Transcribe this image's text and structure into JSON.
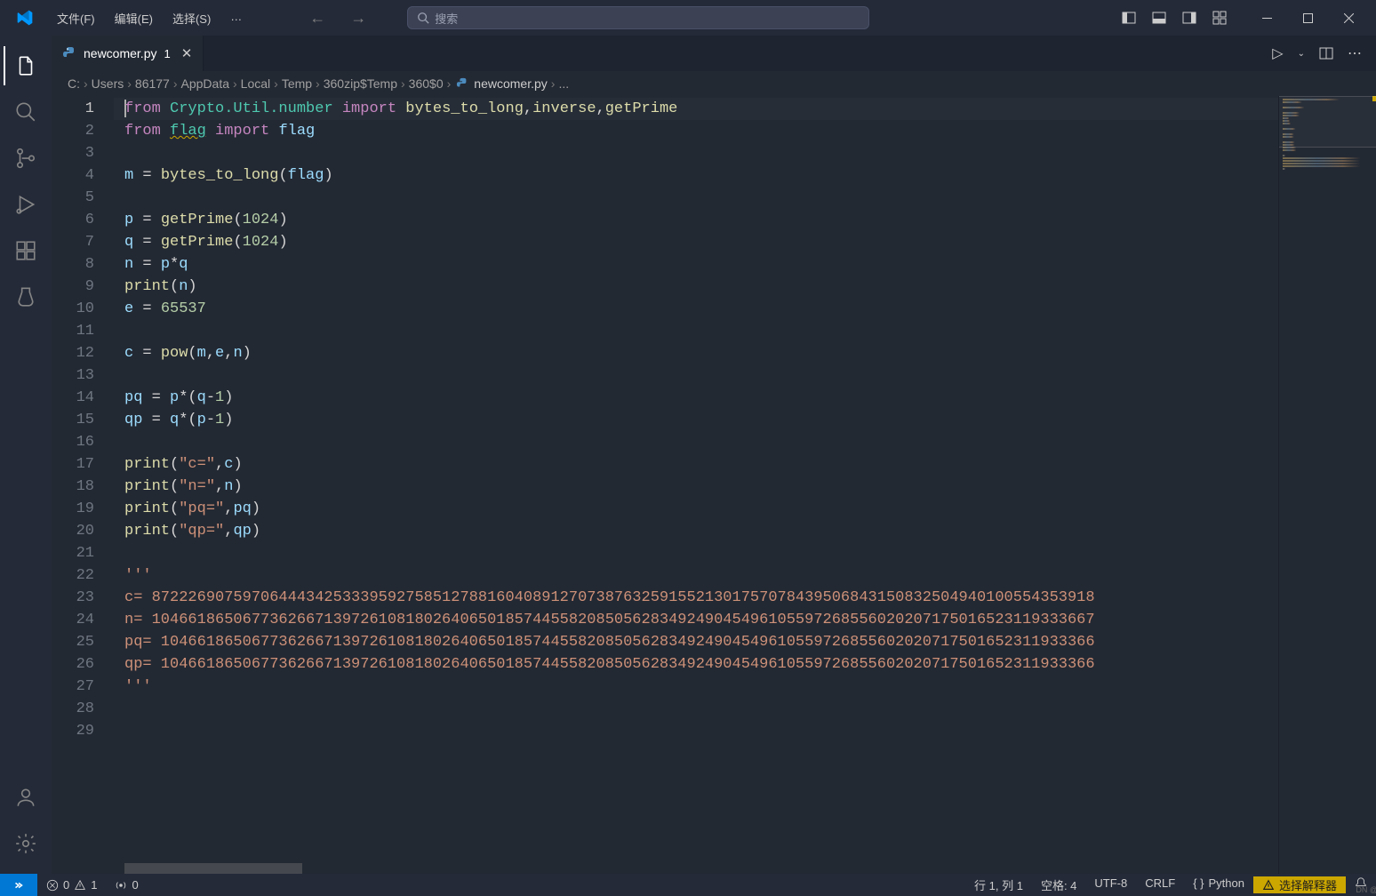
{
  "titlebar": {
    "menu": [
      "文件(F)",
      "编辑(E)",
      "选择(S)",
      "…"
    ],
    "searchPlaceholder": "搜索"
  },
  "tab": {
    "filename": "newcomer.py",
    "modified_indicator": "1"
  },
  "breadcrumb": [
    "C:",
    "Users",
    "86177",
    "AppData",
    "Local",
    "Temp",
    "360zip$Temp",
    "360$0",
    "newcomer.py",
    "..."
  ],
  "code": {
    "lines": [
      {
        "n": 1,
        "tokens": [
          {
            "t": "k",
            "v": "from"
          },
          {
            "t": "p",
            "v": " "
          },
          {
            "t": "t",
            "v": "Crypto.Util.number"
          },
          {
            "t": "p",
            "v": " "
          },
          {
            "t": "k",
            "v": "import"
          },
          {
            "t": "p",
            "v": " "
          },
          {
            "t": "f",
            "v": "bytes_to_long"
          },
          {
            "t": "p",
            "v": ","
          },
          {
            "t": "f",
            "v": "inverse"
          },
          {
            "t": "p",
            "v": ","
          },
          {
            "t": "f",
            "v": "getPrime"
          }
        ],
        "current": true,
        "cursor": true
      },
      {
        "n": 2,
        "tokens": [
          {
            "t": "k",
            "v": "from"
          },
          {
            "t": "p",
            "v": " "
          },
          {
            "t": "t underline",
            "v": "flag"
          },
          {
            "t": "p",
            "v": " "
          },
          {
            "t": "k",
            "v": "import"
          },
          {
            "t": "p",
            "v": " "
          },
          {
            "t": "v",
            "v": "flag"
          }
        ]
      },
      {
        "n": 3,
        "tokens": []
      },
      {
        "n": 4,
        "tokens": [
          {
            "t": "v",
            "v": "m"
          },
          {
            "t": "p",
            "v": " = "
          },
          {
            "t": "f",
            "v": "bytes_to_long"
          },
          {
            "t": "p",
            "v": "("
          },
          {
            "t": "v",
            "v": "flag"
          },
          {
            "t": "p",
            "v": ")"
          }
        ]
      },
      {
        "n": 5,
        "tokens": []
      },
      {
        "n": 6,
        "tokens": [
          {
            "t": "v",
            "v": "p"
          },
          {
            "t": "p",
            "v": " = "
          },
          {
            "t": "f",
            "v": "getPrime"
          },
          {
            "t": "p",
            "v": "("
          },
          {
            "t": "n",
            "v": "1024"
          },
          {
            "t": "p",
            "v": ")"
          }
        ]
      },
      {
        "n": 7,
        "tokens": [
          {
            "t": "v",
            "v": "q"
          },
          {
            "t": "p",
            "v": " = "
          },
          {
            "t": "f",
            "v": "getPrime"
          },
          {
            "t": "p",
            "v": "("
          },
          {
            "t": "n",
            "v": "1024"
          },
          {
            "t": "p",
            "v": ")"
          }
        ]
      },
      {
        "n": 8,
        "tokens": [
          {
            "t": "v",
            "v": "n"
          },
          {
            "t": "p",
            "v": " = "
          },
          {
            "t": "v",
            "v": "p"
          },
          {
            "t": "p",
            "v": "*"
          },
          {
            "t": "v",
            "v": "q"
          }
        ]
      },
      {
        "n": 9,
        "tokens": [
          {
            "t": "f",
            "v": "print"
          },
          {
            "t": "p",
            "v": "("
          },
          {
            "t": "v",
            "v": "n"
          },
          {
            "t": "p",
            "v": ")"
          }
        ]
      },
      {
        "n": 10,
        "tokens": [
          {
            "t": "v",
            "v": "e"
          },
          {
            "t": "p",
            "v": " = "
          },
          {
            "t": "n",
            "v": "65537"
          }
        ]
      },
      {
        "n": 11,
        "tokens": []
      },
      {
        "n": 12,
        "tokens": [
          {
            "t": "v",
            "v": "c"
          },
          {
            "t": "p",
            "v": " = "
          },
          {
            "t": "f",
            "v": "pow"
          },
          {
            "t": "p",
            "v": "("
          },
          {
            "t": "v",
            "v": "m"
          },
          {
            "t": "p",
            "v": ","
          },
          {
            "t": "v",
            "v": "e"
          },
          {
            "t": "p",
            "v": ","
          },
          {
            "t": "v",
            "v": "n"
          },
          {
            "t": "p",
            "v": ")"
          }
        ]
      },
      {
        "n": 13,
        "tokens": []
      },
      {
        "n": 14,
        "tokens": [
          {
            "t": "v",
            "v": "pq"
          },
          {
            "t": "p",
            "v": " = "
          },
          {
            "t": "v",
            "v": "p"
          },
          {
            "t": "p",
            "v": "*("
          },
          {
            "t": "v",
            "v": "q"
          },
          {
            "t": "p",
            "v": "-"
          },
          {
            "t": "n",
            "v": "1"
          },
          {
            "t": "p",
            "v": ")"
          }
        ]
      },
      {
        "n": 15,
        "tokens": [
          {
            "t": "v",
            "v": "qp"
          },
          {
            "t": "p",
            "v": " = "
          },
          {
            "t": "v",
            "v": "q"
          },
          {
            "t": "p",
            "v": "*("
          },
          {
            "t": "v",
            "v": "p"
          },
          {
            "t": "p",
            "v": "-"
          },
          {
            "t": "n",
            "v": "1"
          },
          {
            "t": "p",
            "v": ")"
          }
        ]
      },
      {
        "n": 16,
        "tokens": []
      },
      {
        "n": 17,
        "tokens": [
          {
            "t": "f",
            "v": "print"
          },
          {
            "t": "p",
            "v": "("
          },
          {
            "t": "s",
            "v": "\"c=\""
          },
          {
            "t": "p",
            "v": ","
          },
          {
            "t": "v",
            "v": "c"
          },
          {
            "t": "p",
            "v": ")"
          }
        ]
      },
      {
        "n": 18,
        "tokens": [
          {
            "t": "f",
            "v": "print"
          },
          {
            "t": "p",
            "v": "("
          },
          {
            "t": "s",
            "v": "\"n=\""
          },
          {
            "t": "p",
            "v": ","
          },
          {
            "t": "v",
            "v": "n"
          },
          {
            "t": "p",
            "v": ")"
          }
        ]
      },
      {
        "n": 19,
        "tokens": [
          {
            "t": "f",
            "v": "print"
          },
          {
            "t": "p",
            "v": "("
          },
          {
            "t": "s",
            "v": "\"pq=\""
          },
          {
            "t": "p",
            "v": ","
          },
          {
            "t": "v",
            "v": "pq"
          },
          {
            "t": "p",
            "v": ")"
          }
        ]
      },
      {
        "n": 20,
        "tokens": [
          {
            "t": "f",
            "v": "print"
          },
          {
            "t": "p",
            "v": "("
          },
          {
            "t": "s",
            "v": "\"qp=\""
          },
          {
            "t": "p",
            "v": ","
          },
          {
            "t": "v",
            "v": "qp"
          },
          {
            "t": "p",
            "v": ")"
          }
        ]
      },
      {
        "n": 21,
        "tokens": []
      },
      {
        "n": 22,
        "tokens": [
          {
            "t": "s",
            "v": "'''"
          }
        ]
      },
      {
        "n": 23,
        "tokens": [
          {
            "t": "s",
            "v": "c= 87222690759706444342533395927585127881604089127073876325915521301757078439506843150832504940100554353918"
          }
        ]
      },
      {
        "n": 24,
        "tokens": [
          {
            "t": "s",
            "v": "n= 10466186506773626671397261081802640650185744558208505628349249045496105597268556020207175016523119333667"
          }
        ]
      },
      {
        "n": 25,
        "tokens": [
          {
            "t": "s",
            "v": "pq= 1046618650677362667139726108180264065018574455820850562834924904549610559726855602020717501652311933366"
          }
        ]
      },
      {
        "n": 26,
        "tokens": [
          {
            "t": "s",
            "v": "qp= 1046618650677362667139726108180264065018574455820850562834924904549610559726855602020717501652311933366"
          }
        ]
      },
      {
        "n": 27,
        "tokens": [
          {
            "t": "s",
            "v": "'''"
          }
        ]
      },
      {
        "n": 28,
        "tokens": []
      },
      {
        "n": 29,
        "tokens": []
      }
    ]
  },
  "statusbar": {
    "errors": "0",
    "warnings": "1",
    "ports": "0",
    "cursor": "行 1, 列 1",
    "spaces": "空格: 4",
    "encoding": "UTF-8",
    "eol": "CRLF",
    "language": "Python",
    "interpreter": "选择解释器"
  },
  "watermark": "DN @"
}
